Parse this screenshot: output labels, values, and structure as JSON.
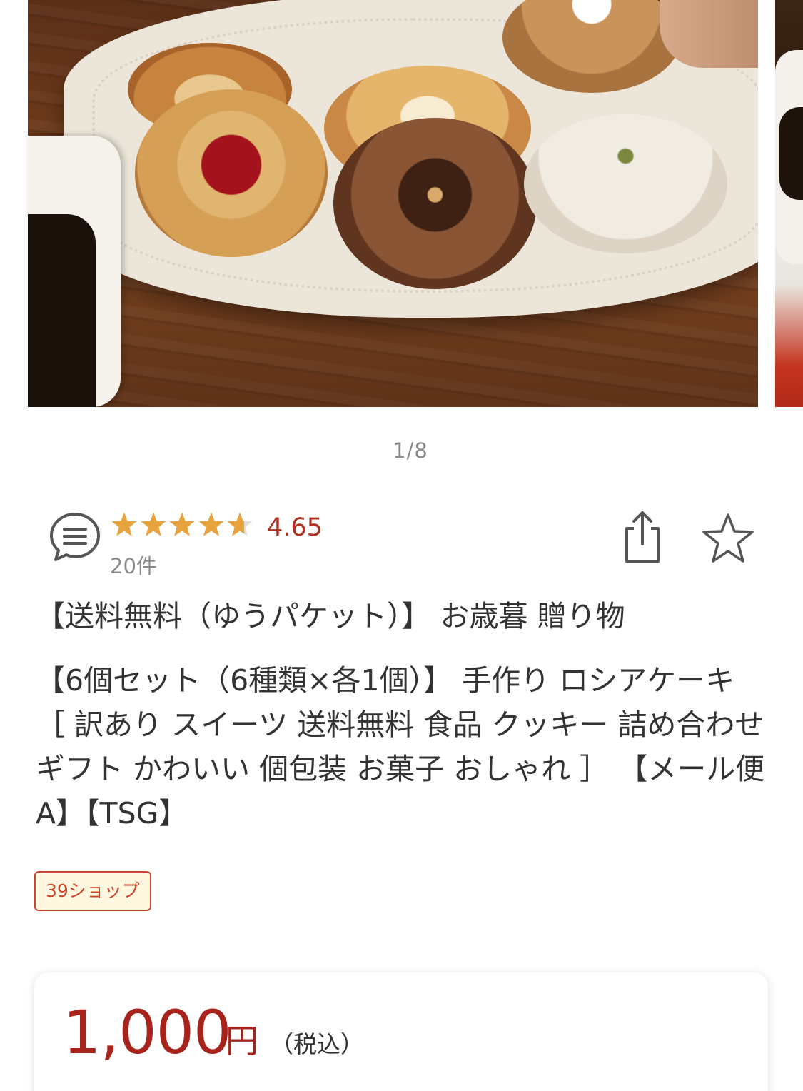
{
  "carousel": {
    "pager": "1/8"
  },
  "rating": {
    "value": "4.65",
    "count": "20件",
    "stars": 4.65,
    "star_color": "#E6A33E",
    "value_color": "#B0301F"
  },
  "actions": {
    "share_icon": "share-icon",
    "favorite_icon": "star-outline-icon"
  },
  "product": {
    "headline": "【送料無料（ゆうパケット）】 お歳暮 贈り物",
    "name": "【6個セット（6種類×各1個）】 手作り ロシアケーキ ［ 訳あり スイーツ 送料無料 食品 クッキー 詰め合わせ ギフト かわいい 個包装 お菓子 おしゃれ ］ 【メール便A】【TSG】"
  },
  "shop_badge": {
    "label": "39ショップ",
    "color": "#C9452B",
    "background": "#FFF7E0"
  },
  "price": {
    "amount": "1,000",
    "unit": "円",
    "tax_note": "（税込）",
    "color": "#A8231C"
  }
}
